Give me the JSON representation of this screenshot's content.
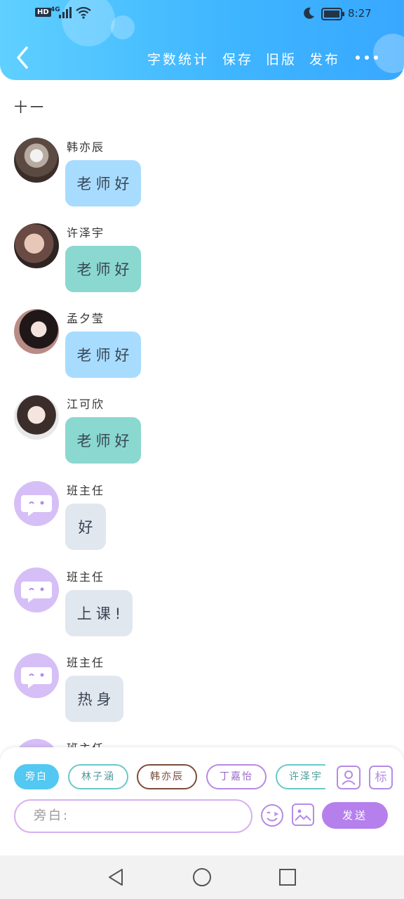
{
  "status_bar": {
    "hd": "HD",
    "network": "4G",
    "time": "8:27"
  },
  "header": {
    "menu": [
      "字数统计",
      "保存",
      "旧版",
      "发布"
    ]
  },
  "chapter_label": "十一",
  "messages": [
    {
      "name": "韩亦辰",
      "text": "老师好"
    },
    {
      "name": "许泽宇",
      "text": "老师好"
    },
    {
      "name": "孟夕莹",
      "text": "老师好"
    },
    {
      "name": "江可欣",
      "text": "老师好"
    },
    {
      "name": "班主任",
      "text": "好"
    },
    {
      "name": "班主任",
      "text": "上课!"
    },
    {
      "name": "班主任",
      "text": "热身"
    },
    {
      "name": "班主任",
      "text": ""
    }
  ],
  "composer": {
    "roles": [
      "旁白",
      "林子涵",
      "韩亦辰",
      "丁嘉怡",
      "许泽宇"
    ],
    "tag_label": "标",
    "input_placeholder": "旁白:",
    "send_label": "发送"
  },
  "colors": {
    "header_start": "#5fd0ff",
    "header_end": "#38a8ff",
    "accent_purple": "#b680ec",
    "bubble_blue": "#a7dcff",
    "bubble_green": "#8ad8cf",
    "bubble_gray": "#e1e7ee"
  }
}
